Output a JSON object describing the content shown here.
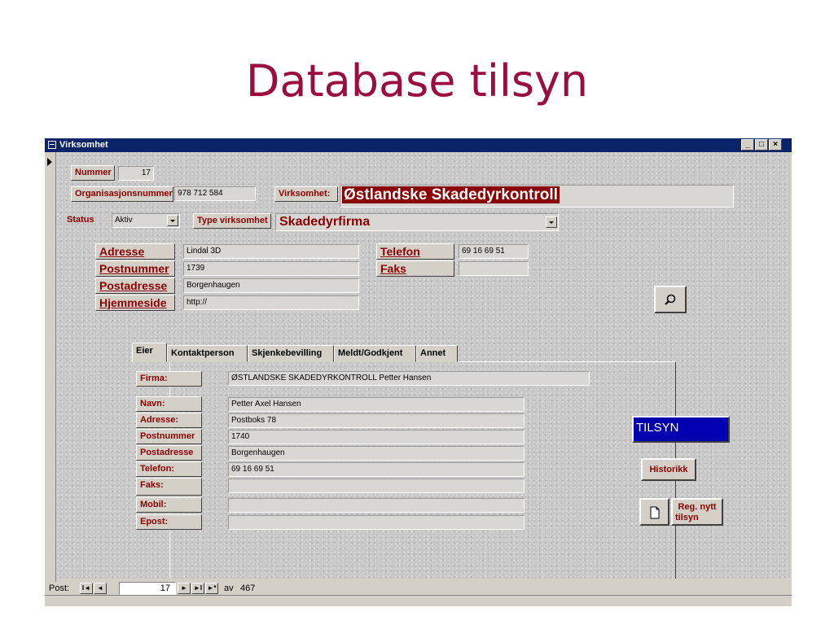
{
  "slide": {
    "title": "Database tilsyn"
  },
  "window": {
    "title": "Virksomhet",
    "min": "_",
    "max": "□",
    "close": "×"
  },
  "form": {
    "nummer_label": "Nummer",
    "nummer_value": "17",
    "orgnr_label": "Organisasjonsnummer",
    "orgnr_value": "978 712 584",
    "virksomhet_label": "Virksomhet:",
    "virksomhet_value": "Østlandske Skadedyrkontroll",
    "status_label": "Status",
    "status_value": "Aktiv",
    "type_label": "Type virksomhet",
    "type_value": "Skadedyrfirma",
    "adresse_label": "Adresse",
    "adresse_value": "Lindal 3D",
    "postnummer_label": "Postnummer",
    "postnummer_value": "1739",
    "postadresse_label": "Postadresse",
    "postadresse_value": "Borgenhaugen",
    "hjemmeside_label": "Hjemmeside",
    "hjemmeside_value": "http://",
    "telefon_label": "Telefon",
    "telefon_value": "69 16 69 51",
    "faks_label": "Faks",
    "faks_value": ""
  },
  "tabs": [
    "Eier",
    "Kontaktperson",
    "Skjenkebevilling",
    "Meldt/Godkjent",
    "Annet"
  ],
  "owner": {
    "firma_label": "Firma:",
    "firma_value": "ØSTLANDSKE SKADEDYRKONTROLL Petter Hansen",
    "navn_label": "Navn:",
    "navn_value": "Petter Axel Hansen",
    "adresse_label": "Adresse:",
    "adresse_value": "Postboks 78",
    "postnummer_label": "Postnummer",
    "postnummer_value": "1740",
    "postadresse_label": "Postadresse",
    "postadresse_value": "Borgenhaugen",
    "telefon_label": "Telefon:",
    "telefon_value": "69 16 69 51",
    "faks_label": "Faks:",
    "faks_value": "",
    "mobil_label": "Mobil:",
    "mobil_value": "",
    "epost_label": "Epost:",
    "epost_value": ""
  },
  "buttons": {
    "tilsyn": "TILSYN",
    "historikk": "Historikk",
    "reg_nytt_line1": "Reg. nytt",
    "reg_nytt_line2": "tilsyn"
  },
  "navigation": {
    "label": "Post:",
    "current": "17",
    "of_label": "av",
    "total": "467",
    "first": "I◄",
    "prev": "◄",
    "next": "►",
    "last": "►I",
    "new": "►*"
  },
  "colors": {
    "title": "#9b0d3c",
    "label_text": "#8b0000",
    "titlebar": "#0a246a",
    "tilsyn_button": "#0000b0",
    "virksomhet_highlight": "#8b0000"
  }
}
